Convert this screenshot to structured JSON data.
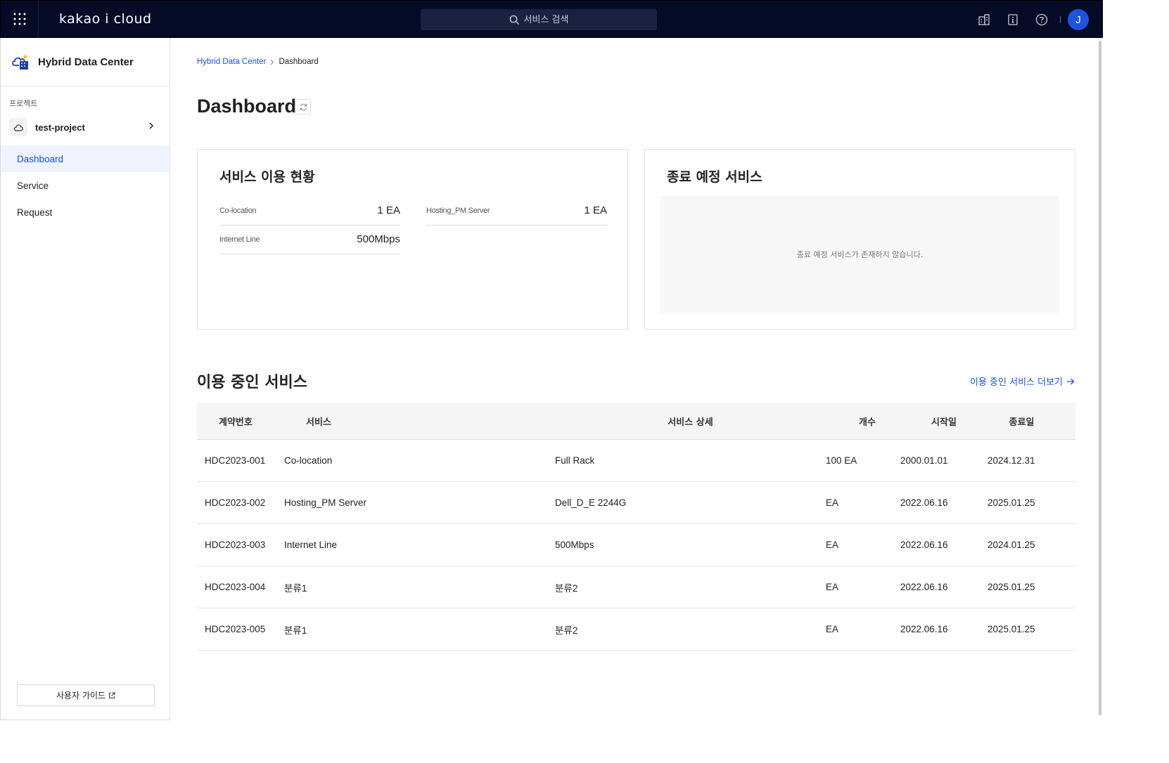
{
  "topbar": {
    "logo": "kakao i cloud",
    "search_placeholder": "서비스 검색",
    "avatar_initial": "J"
  },
  "sidebar": {
    "title": "Hybrid Data Center",
    "project_label": "프로젝트",
    "project_name": "test-project",
    "nav": [
      {
        "label": "Dashboard",
        "active": true
      },
      {
        "label": "Service",
        "active": false
      },
      {
        "label": "Request",
        "active": false
      }
    ],
    "guide_label": "사용자 가이드"
  },
  "breadcrumb": {
    "parent": "Hybrid Data Center",
    "current": "Dashboard"
  },
  "page_title": "Dashboard",
  "usage_card": {
    "title": "서비스 이용 현황",
    "stats": [
      {
        "label": "Co-location",
        "value": "1 EA"
      },
      {
        "label": "Hosting_PM Server",
        "value": "1 EA"
      },
      {
        "label": "Internet Line",
        "value": "500Mbps"
      }
    ]
  },
  "ending_card": {
    "title": "종료 예정 서비스",
    "empty_message": "종료 예정 서비스가 존재하지 않습니다."
  },
  "services": {
    "title": "이용 중인 서비스",
    "more_link": "이용 중인 서비스 더보기",
    "columns": [
      "계약번호",
      "서비스",
      "서비스 상세",
      "개수",
      "시작일",
      "종료일"
    ],
    "rows": [
      [
        "HDC2023-001",
        "Co-location",
        "Full Rack",
        "100 EA",
        "2000.01.01",
        "2024.12.31"
      ],
      [
        "HDC2023-002",
        "Hosting_PM Server",
        "Dell_D_E 2244G",
        "EA",
        "2022.06.16",
        "2025.01.25"
      ],
      [
        "HDC2023-003",
        "Internet Line",
        "500Mbps",
        "EA",
        "2022.06.16",
        "2024.01.25"
      ],
      [
        "HDC2023-004",
        "분류1",
        "분류2",
        "EA",
        "2022.06.16",
        "2025.01.25"
      ],
      [
        "HDC2023-005",
        "분류1",
        "분류2",
        "EA",
        "2022.06.16",
        "2025.01.25"
      ]
    ]
  },
  "colors": {
    "topbar_bg": "#050b26",
    "accent": "#1a4fd6",
    "avatar": "#1f52e0",
    "active_nav_bg": "#eef3fe"
  }
}
